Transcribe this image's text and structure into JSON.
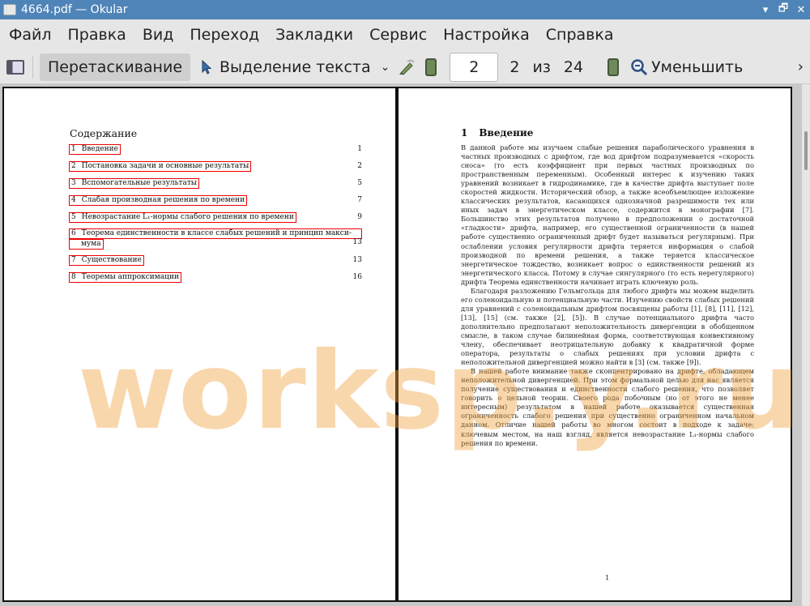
{
  "window": {
    "title": "4664.pdf  — Okular",
    "minimize": "▾",
    "restore": "🗗",
    "close": "✕"
  },
  "menu": [
    "Файл",
    "Правка",
    "Вид",
    "Переход",
    "Закладки",
    "Сервис",
    "Настройка",
    "Справка"
  ],
  "toolbar": {
    "browse_label": "Перетаскивание",
    "select_label": "Выделение текста",
    "dropdown": "⌄",
    "page_input": "2",
    "current_page": "2",
    "of_label": "из",
    "total_pages": "24",
    "zoom_out_label": "Уменьшить",
    "more": "›"
  },
  "toc": {
    "title": "Содержание",
    "entries": [
      {
        "n": "1",
        "label": "Введение",
        "page": "1"
      },
      {
        "n": "2",
        "label": "Постановка задачи и основные результаты",
        "page": "2"
      },
      {
        "n": "3",
        "label": "Вспомогательные результаты",
        "page": "5"
      },
      {
        "n": "4",
        "label": "Слабая производная решения по времени",
        "page": "7"
      },
      {
        "n": "5",
        "label": "Невозрастание L₁-нормы слабого решения по времени",
        "page": "9"
      },
      {
        "n": "6",
        "label": "Теорема единственности в классе слабых решений и принцип макси-",
        "label2": "мума",
        "page": "13"
      },
      {
        "n": "7",
        "label": "Существование",
        "page": "13"
      },
      {
        "n": "8",
        "label": "Теоремы аппроксимации",
        "page": "16"
      }
    ]
  },
  "section": {
    "number": "1",
    "title": "Введение",
    "paragraphs": [
      "В данной работе мы изучаем слабые решения параболического уравнения в частных производных с дрифтом, где вод дрифтом подразумевается «скорость сноса» (то есть коэффициент при первых частных производных по пространственным переменным). Особенный интерес к изучению таких уравнений возникает в гидродинамике, где в качестве дрифта выступает поле скоростей жидкости. Исторический обзор, а также всеобъемлющее изложение классических результатов, касающихся однозначной разрешимости тех или иных задач в энергетическом классе, содержится в монографии [7]. Большинство этих результатов получено в предположении о достаточной «гладкости» дрифта, например, его существенной ограниченности (в нашей работе существенно ограниченный дрифт будет называться регулярным). При ослаблении условия регулярности дрифта теряется информация о слабой производной по времени решения, а также теряется классическое энергетическое тождество, возникает вопрос о единственности решений из энергетического класса. Потому в случае сингулярного (то есть нерегулярного) дрифта Теорема единственности начинает играть ключевую роль.",
      "Благодаря разложению Гельмгольца для любого дрифта мы можем выделить его соленоидальную и потенциальную части. Изучению свойств слабых решений для уравнений с соленоидальным дрифтом посвящены работы [1], [8], [11], [12], [13], [15] (см. также [2], [5]). В случае потенциального дрифта часто дополнительно предполагают неположительность дивергенции в обобщенном смысле, в таком случае билинейная форма, соответствующая конвективному члену, обеспечивает неотрицательную добавку к квадратичной форме оператора, результаты о слабых решениях при условии дрифта с неположительной дивергенцией можно найти в [3] (см. также [9]).",
      "В нашей работе внимание также сконцентрировано на дрифте, обладающем неположительной дивергенцией. При этом формальной целью для нас является получение существования и единственности слабого решения, что позволяет говорить о цельной теории. Своего рода побочным (но от этого не менее интересным) результатом в нашей работе оказывается существенная ограниченность слабого решения при существенно ограниченном начальном данном. Отличие нашей работы во многом состоит в подходе к задаче: ключевым местом, на наш взгляд, является невозрастание L₁-нормы слабого решения по времени."
    ],
    "page_number": "1"
  },
  "watermark": "worksp.y.ru"
}
